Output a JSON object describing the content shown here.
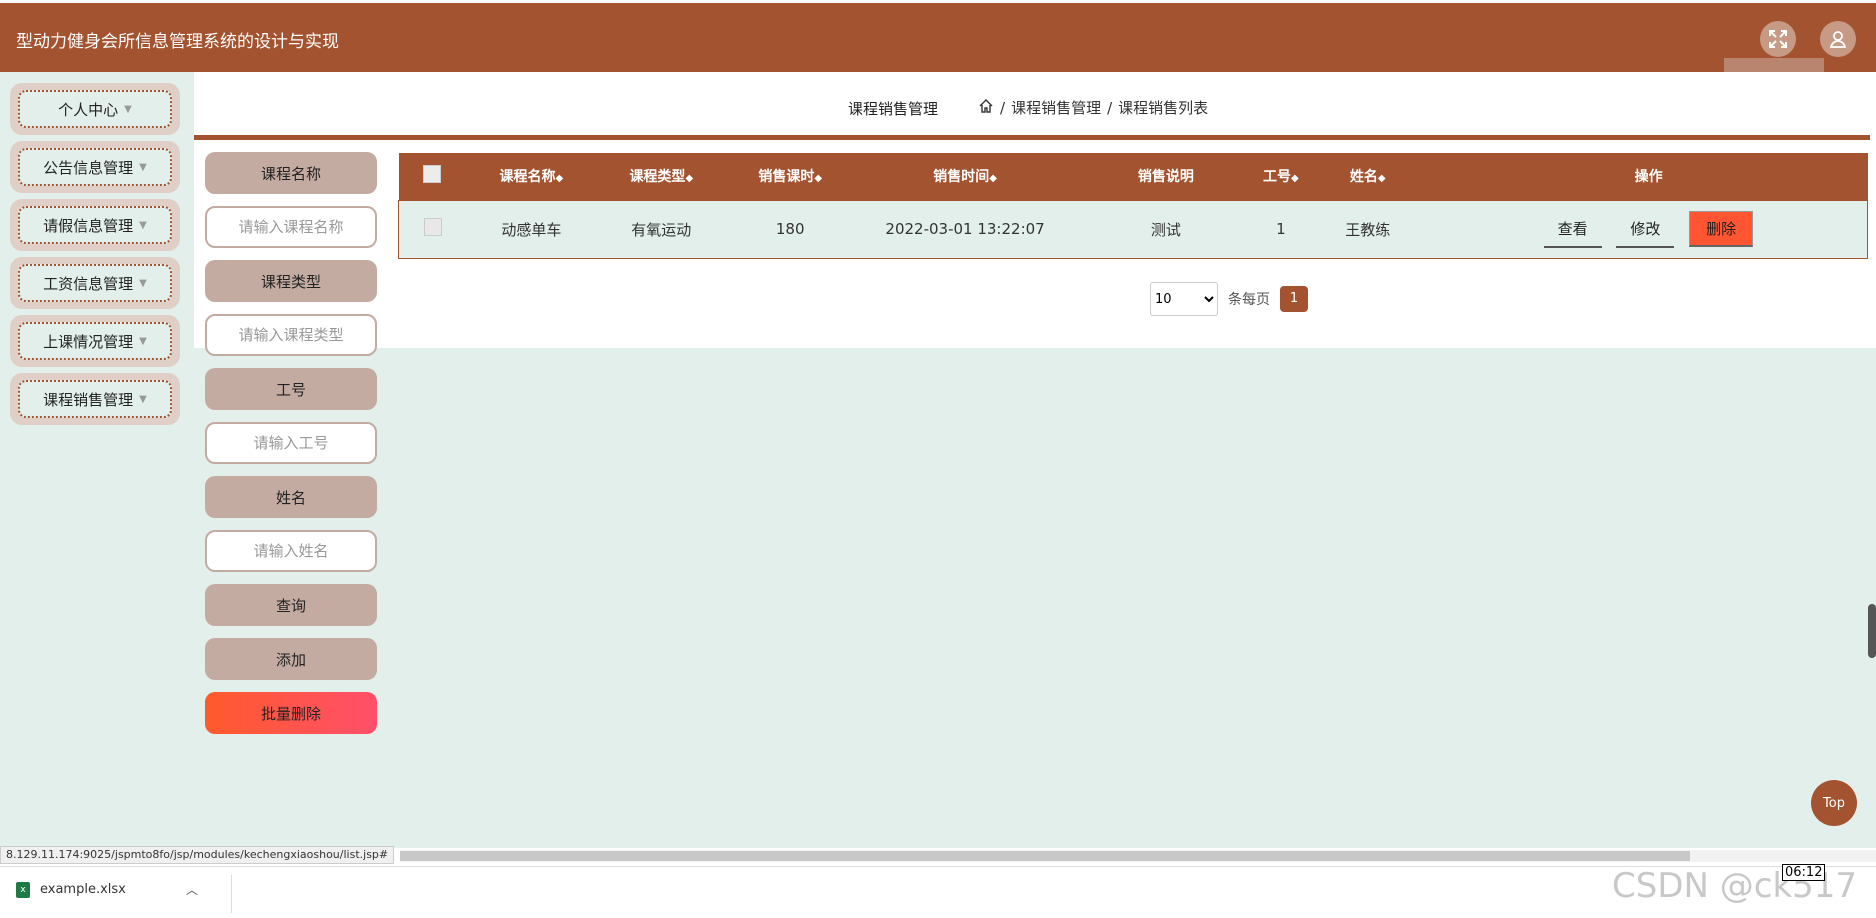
{
  "app": {
    "title": "型动力健身会所信息管理系统的设计与实现"
  },
  "sidebar": {
    "items": [
      {
        "label": "个人中心"
      },
      {
        "label": "公告信息管理"
      },
      {
        "label": "请假信息管理"
      },
      {
        "label": "工资信息管理"
      },
      {
        "label": "上课情况管理"
      },
      {
        "label": "课程销售管理"
      }
    ]
  },
  "header": {
    "page_title": "课程销售管理",
    "breadcrumb": [
      "课程销售管理",
      "课程销售列表"
    ],
    "separator": "/"
  },
  "search": {
    "course_name_label": "课程名称",
    "course_name_placeholder": "请输入课程名称",
    "course_type_label": "课程类型",
    "course_type_placeholder": "请输入课程类型",
    "staff_id_label": "工号",
    "staff_id_placeholder": "请输入工号",
    "name_label": "姓名",
    "name_placeholder": "请输入姓名",
    "query_button": "查询",
    "add_button": "添加",
    "batch_delete_button": "批量删除"
  },
  "table": {
    "headers": [
      "课程名称",
      "课程类型",
      "销售课时",
      "销售时间",
      "销售说明",
      "工号",
      "姓名",
      "操作"
    ],
    "sort_glyph": "◆",
    "rows": [
      {
        "course_name": "动感单车",
        "course_type": "有氧运动",
        "hours": "180",
        "time": "2022-03-01 13:22:07",
        "note": "测试",
        "staff_id": "1",
        "name": "王教练",
        "actions": {
          "view": "查看",
          "edit": "修改",
          "delete": "删除"
        }
      }
    ]
  },
  "pagination": {
    "page_size": "10",
    "per_page_label": "条每页",
    "current_page": "1",
    "options": [
      "10"
    ]
  },
  "top_button": {
    "label": "Top"
  },
  "status": {
    "url": "8.129.11.174:9025/jspmto8fo/jsp/modules/kechengxiaoshou/list.jsp#"
  },
  "downloads": {
    "file": "example.xlsx"
  },
  "watermark": {
    "text": "CSDN @ck517"
  },
  "clock": {
    "time": "06:12"
  },
  "colors": {
    "brand": "#a3532f",
    "background": "#e2efeb",
    "danger": "#ff5533"
  }
}
